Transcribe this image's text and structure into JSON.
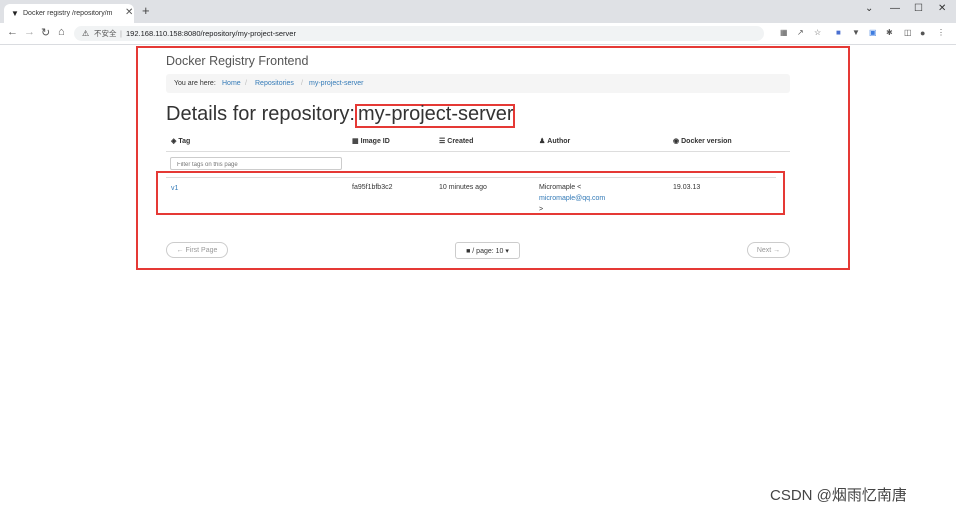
{
  "browser": {
    "tab_title": "Docker registry /repository/m",
    "tab_close": "✕",
    "new_tab": "+",
    "insecure_label": "不安全",
    "url": "192.168.110.158:8080/repository/my-project-server",
    "window_controls": [
      "⌄",
      "—",
      "☐",
      "✕"
    ]
  },
  "app": {
    "brand": "Docker Registry Frontend",
    "breadcrumb": {
      "prefix": "You are here:",
      "items": [
        "Home",
        "Repositories",
        "my-project-server"
      ]
    },
    "title_prefix": "Details for repository:",
    "repository": "my-project-server",
    "table": {
      "headers": {
        "tag": "Tag",
        "image_id": "Image ID",
        "created": "Created",
        "author": "Author",
        "docker_version": "Docker version"
      },
      "filter_placeholder": "Filter tags on this page",
      "rows": [
        {
          "tag": "v1",
          "image_id": "fa95f1bfb3c2",
          "created": "10 minutes ago",
          "author_name": "Micromaple <",
          "author_email": "micromaple@qq.com",
          "author_close": ">",
          "docker_version": "19.03.13"
        }
      ]
    },
    "pagination": {
      "first": "← First Page",
      "per_page_label": "/ page: 10",
      "next": "Next →"
    }
  },
  "watermark": "CSDN @烟雨忆南唐",
  "colors": {
    "link": "#337ab7",
    "highlight": "#e53935"
  },
  "icons": {
    "tag": "tag-icon",
    "image_id": "qrcode-icon",
    "created": "list-icon",
    "author": "user-icon",
    "docker_version": "eye-icon"
  }
}
